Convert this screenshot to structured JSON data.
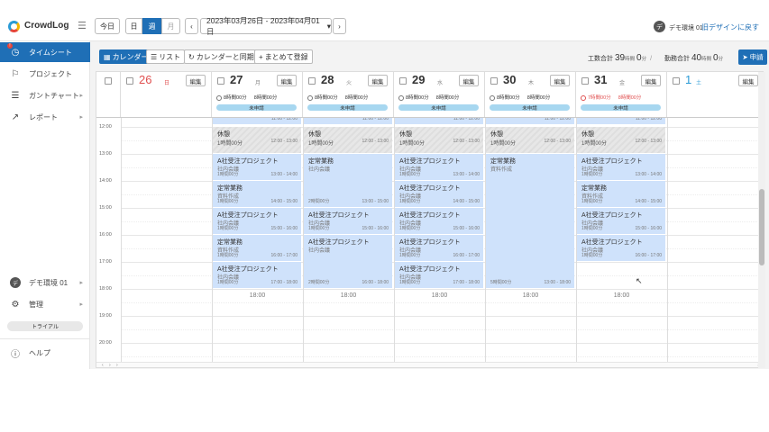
{
  "app": {
    "logo_text": "CrowdLog",
    "menu_icon": "hamburger-icon"
  },
  "header": {
    "today": "今日",
    "view_day": "日",
    "view_week": "週",
    "view_month": "月",
    "prev": "‹",
    "next": "›",
    "range_label": "2023年03月26日 - 2023年04月01日",
    "range_caret": "▾",
    "user_initial": "デ",
    "user_name": "デモ環境 01",
    "old_design": "旧デザインに戻す"
  },
  "sidebar": {
    "items": [
      {
        "label": "タイムシート",
        "icon": "clock-icon",
        "active": true,
        "badge": "!"
      },
      {
        "label": "プロジェクト",
        "icon": "flag-icon"
      },
      {
        "label": "ガントチャート",
        "icon": "gantt-icon",
        "chev": "▸"
      },
      {
        "label": "レポート",
        "icon": "trend-icon",
        "chev": "▸"
      }
    ],
    "bottom": [
      {
        "label": "デモ環境 01",
        "icon": "user-avatar-icon",
        "initial": "デ",
        "chev": "▸"
      },
      {
        "label": "管理",
        "icon": "gear-icon",
        "chev": "▸"
      }
    ],
    "trial": "トライアル",
    "help": "ヘルプ",
    "help_icon": "help-icon"
  },
  "toolbar": {
    "calendar": "カレンダー",
    "list": "リスト",
    "sync": "カレンダーと同期",
    "bulk": "まとめて登録",
    "work_total_label": "工数合計",
    "work_total_h": "39",
    "work_total_h_unit": "時間",
    "work_total_m": "0",
    "work_total_m_unit": "分",
    "sep": "/",
    "attend_total_label": "勤務合計",
    "attend_total_h": "40",
    "attend_total_h_unit": "時間",
    "attend_total_m": "0",
    "attend_total_m_unit": "分",
    "apply": "申請"
  },
  "calendar": {
    "edit_label": "編集",
    "days": [
      {
        "num": "26",
        "wd": "日",
        "type": "sun"
      },
      {
        "num": "27",
        "wd": "月",
        "a": "8時間00分",
        "b": "8時間00分",
        "status": "未申請"
      },
      {
        "num": "28",
        "wd": "火",
        "a": "8時間00分",
        "b": "8時間00分",
        "status": "未申請"
      },
      {
        "num": "29",
        "wd": "水",
        "a": "8時間00分",
        "b": "8時間00分",
        "status": "未申請"
      },
      {
        "num": "30",
        "wd": "木",
        "a": "8時間00分",
        "b": "8時間00分",
        "status": "未申請"
      },
      {
        "num": "31",
        "wd": "金",
        "a": "7時間00分",
        "b": "8時間00分",
        "status": "未申請",
        "red": true
      },
      {
        "num": "1",
        "wd": "土",
        "type": "sat"
      }
    ],
    "times": [
      "12:00",
      "13:00",
      "14:00",
      "15:00",
      "16:00",
      "17:00",
      "18:00",
      "19:00",
      "20:00"
    ],
    "end_label": "18:00",
    "events": {
      "rest": {
        "title": "休憩",
        "dur": "1時間00分",
        "range": "12:00 - 13:00"
      },
      "a_1314": {
        "title": "A社受注プロジェクト",
        "sub": "社内会議",
        "dur": "1時間00分",
        "range": "13:00 - 14:00"
      },
      "t_1415": {
        "title": "定常業務",
        "sub": "資料作成",
        "dur": "1時間00分",
        "range": "14:00 - 15:00"
      },
      "a_1516": {
        "title": "A社受注プロジェクト",
        "sub": "社内会議",
        "dur": "1時間00分",
        "range": "15:00 - 16:00"
      },
      "t_1617": {
        "title": "定常業務",
        "sub": "資料作成",
        "dur": "1時間00分",
        "range": "16:00 - 17:00"
      },
      "a_1718": {
        "title": "A社受注プロジェクト",
        "sub": "社内会議",
        "dur": "1時間00分",
        "range": "17:00 - 18:00"
      },
      "a_1213": {
        "title": "A社受注プロジェクト",
        "sub": "社内会議",
        "dur": "1時間00分",
        "range": "12:00 - 13:00"
      },
      "a_1618": {
        "title": "A社受注プロジェクト",
        "sub": "社内会議",
        "dur": "2時間00分",
        "range": "16:00 - 18:00"
      },
      "t_1318": {
        "title": "定常業務",
        "sub": "資料作成",
        "dur": "5時間00分",
        "range": "13:00 - 18:00"
      },
      "t_1315": {
        "title": "定常業務",
        "sub": "社内会議",
        "dur": "2時間00分",
        "range": "13:00 - 15:00"
      },
      "a_1516b": {
        "title": "A社受注プロジェクト",
        "sub": "社内会議",
        "dur": "2時間00分",
        "range": "15:00 - 17:00"
      },
      "a_1617": {
        "title": "A社受注プロジェクト",
        "sub": "社内会議",
        "dur": "1時間00分",
        "range": "16:00 - 17:00"
      },
      "a_1314b": {
        "title": "A社受注プロジェクト",
        "sub": "社内会議",
        "dur": "1時間00分",
        "range": "13:00 - 14:00"
      },
      "a_1415": {
        "title": "A社受注プロジェクト",
        "sub": "社内会議",
        "dur": "1時間00分",
        "range": "14:00 - 15:00"
      },
      "a_1516c": {
        "title": "A社受注プロジェクト",
        "sub": "社内会議",
        "dur": "1時間00分",
        "range": "15:00 - 16:00"
      },
      "a_1617b": {
        "title": "A社受注プロジェクト",
        "sub": "社内会議",
        "dur": "1時間00分",
        "range": "16:00 - 17:00"
      },
      "a_1718b": {
        "title": "A社受注プロジェクト",
        "sub": "社内会議",
        "dur": "1時間00分",
        "range": "17:00 - 18:00"
      },
      "top_1": {
        "range": "11:00 - 12:00"
      }
    },
    "scroll_arrows": [
      "‹",
      "›"
    ]
  }
}
